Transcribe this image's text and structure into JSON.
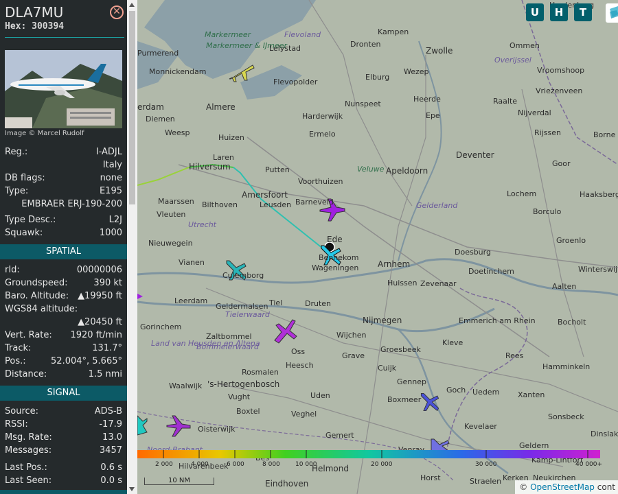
{
  "aircraft": {
    "callsign": "DLA7MU",
    "hex_label": "Hex:",
    "hex": "300394",
    "close_icon": "close-icon",
    "photo_credit": "Image © Marcel Rudolf"
  },
  "details": {
    "reg_label": "Reg.:",
    "reg": "I-ADJL",
    "country": "Italy",
    "dbflags_label": "DB flags:",
    "dbflags": "none",
    "type_label": "Type:",
    "type": "E195",
    "type_name": "EMBRAER ERJ-190-200",
    "typedesc_label": "Type Desc.:",
    "typedesc": "L2J",
    "squawk_label": "Squawk:",
    "squawk": "1000"
  },
  "spatial": {
    "header": "SPATIAL",
    "rid_label": "rId:",
    "rid": "00000006",
    "gs_label": "Groundspeed:",
    "gs": "390 kt",
    "baro_label": "Baro. Altitude:",
    "baro": "▲19950 ft",
    "wgs_label": "WGS84 altitude:",
    "wgs": "▲20450 ft",
    "vrate_label": "Vert. Rate:",
    "vrate": "1920 ft/min",
    "track_label": "Track:",
    "track": "131.7°",
    "pos_label": "Pos.:",
    "pos": "52.004°, 5.665°",
    "dist_label": "Distance:",
    "dist": "1.5 nmi"
  },
  "signal": {
    "header": "SIGNAL",
    "source_label": "Source:",
    "source": "ADS-B",
    "rssi_label": "RSSI:",
    "rssi": "-17.9",
    "msgrate_label": "Msg. Rate:",
    "msgrate": "13.0",
    "messages_label": "Messages:",
    "messages": "3457",
    "lastpos_label": "Last Pos.:",
    "lastpos": "0.6 s",
    "lastseen_label": "Last Seen:",
    "lastseen": "0.0 s"
  },
  "map": {
    "buttons": [
      "U",
      "H",
      "T"
    ],
    "places": [
      "Markermeer",
      "Markermeer & IJmeer",
      "Flevoland",
      "Lelystad",
      "Dronten",
      "Kampen",
      "Zwolle",
      "Ommen",
      "Hardenberg",
      "Purmerend",
      "Monnickendam",
      "Almere",
      "Flevopolder",
      "Elburg",
      "Wezep",
      "Overijssel",
      "Vroomshoop",
      "erdam",
      "Diemen",
      "Nunspeet",
      "Heerde",
      "Raalte",
      "Vriezenveen",
      "Weesp",
      "Huizen",
      "Harderwijk",
      "Epe",
      "Nijverdal",
      "Ermelo",
      "Rijssen",
      "Borne",
      "Laren",
      "Hilversum",
      "Putten",
      "Apeldoorn",
      "Deventer",
      "Goor",
      "Veluwe",
      "Voorthuizen",
      "Amersfoort",
      "Leusden",
      "Barneveld",
      "Gelderland",
      "Lochem",
      "Haaksberge",
      "Maarssen",
      "Bilthoven",
      "Vleuten",
      "Utrecht",
      "Borculo",
      "Nieuwegein",
      "Ede",
      "Bennekom",
      "Doesburg",
      "Groenlo",
      "Vianen",
      "Wageningen",
      "Arnhem",
      "Culemborg",
      "Huissen",
      "Zevenaar",
      "Doetinchem",
      "Aalten",
      "Winterswijk",
      "Leerdam",
      "Tiel",
      "Druten",
      "Geldermalsen",
      "Tielerwaard",
      "Nijmegen",
      "Emmerich am Rhein",
      "Bocholt",
      "Gorinchem",
      "Zaltbommel",
      "Wijchen",
      "Kleve",
      "Rees",
      "Bommelerwaard",
      "Land van Heusden en Altena",
      "Oss",
      "Grave",
      "Groesbeek",
      "Hamminkeln",
      "Heesch",
      "Cuijk",
      "Rosmalen",
      "Waalwijk",
      "'s-Hertogenbosch",
      "Gennep",
      "Goch",
      "Uedem",
      "Xanten",
      "Vught",
      "Uden",
      "Boxmeer",
      "Boxtel",
      "Veghel",
      "Sonsbeck",
      "Oisterwijk",
      "Kevelaer",
      "Noord-Brabant",
      "Gemert",
      "Venray",
      "Geldern",
      "Dinslaken",
      "Kamp-Lintfort",
      "Helmond",
      "Horst",
      "Straelen",
      "Kerken",
      "Neukirchen",
      "Eindhoven",
      "Hilvarenbeek",
      "Bes"
    ],
    "altitude_scale": [
      "2 000",
      "4 000",
      "6 000",
      "8 000",
      "10 000",
      "20 000",
      "30 000",
      "40 000+"
    ],
    "scale_label": "10 NM",
    "attribution_prefix": "©",
    "attribution_link": "OpenStreetMap",
    "attribution_suffix": "cont"
  }
}
